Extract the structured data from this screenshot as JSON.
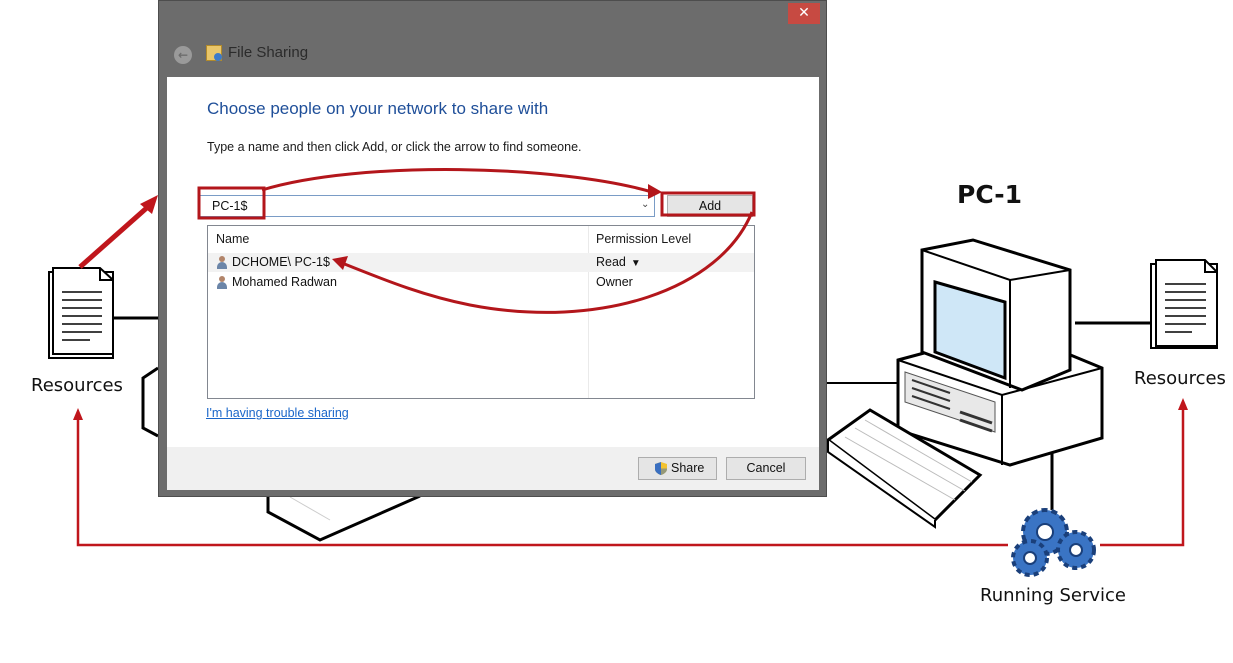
{
  "diagram": {
    "pc_title": "PC-1",
    "resources_left": "Resources",
    "resources_right": "Resources",
    "running_service": "Running Service",
    "accent_color": "#c0161c"
  },
  "window": {
    "title": "File Sharing",
    "close_glyph": "✕",
    "back_glyph": "←",
    "heading": "Choose people on your network to share with",
    "instruction": "Type a name and then click Add, or click the arrow to find someone.",
    "input_value": "PC-1$",
    "dropdown_glyph": "⌄",
    "add_label": "Add",
    "columns": {
      "name": "Name",
      "permission": "Permission Level"
    },
    "rows": [
      {
        "name": "DCHOME\\ PC-1$",
        "permission": "Read",
        "has_dropdown": true
      },
      {
        "name": "Mohamed Radwan",
        "permission": "Owner",
        "has_dropdown": false
      }
    ],
    "perm_arrow": "▼",
    "trouble_link": "I'm having trouble sharing",
    "share_label": "Share",
    "cancel_label": "Cancel"
  }
}
